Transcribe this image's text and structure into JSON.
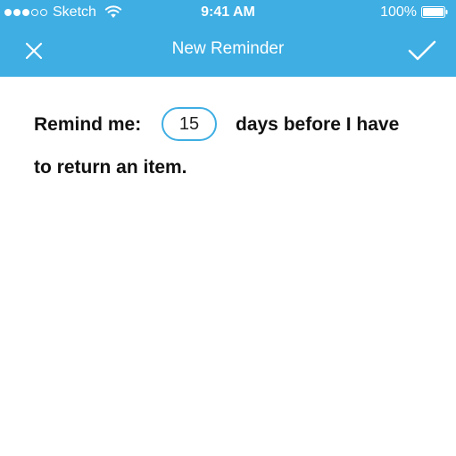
{
  "status_bar": {
    "carrier": "Sketch",
    "time": "9:41 AM",
    "battery": "100%",
    "signal_full_dots": 3,
    "signal_empty_dots": 2
  },
  "nav": {
    "title": "New Reminder",
    "close_icon": "close-icon",
    "confirm_icon": "checkmark-icon"
  },
  "reminder": {
    "prefix": "Remind me:",
    "days_value": "15",
    "suffix_line1": "days before I have",
    "suffix_line2": "to return an item."
  },
  "colors": {
    "accent": "#3eaee3",
    "text": "#111111",
    "background": "#ffffff"
  }
}
